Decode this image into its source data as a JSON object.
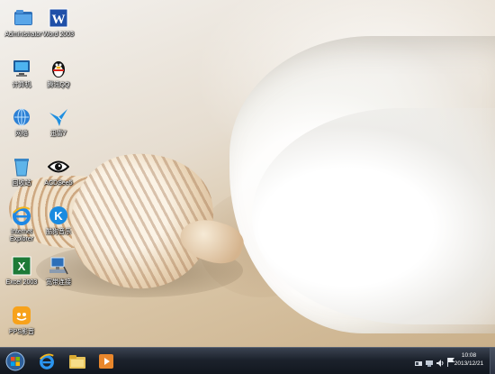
{
  "desktop": {
    "icons": [
      {
        "label": "Administrator",
        "icon": "user-folder-icon"
      },
      {
        "label": "Word 2003",
        "icon": "word-icon"
      },
      {
        "label": "计算机",
        "icon": "computer-icon"
      },
      {
        "label": "腾讯QQ",
        "icon": "qq-penguin-icon"
      },
      {
        "label": "网络",
        "icon": "network-globe-icon"
      },
      {
        "label": "迅雷7",
        "icon": "thunder-bird-icon"
      },
      {
        "label": "回收站",
        "icon": "recycle-bin-icon"
      },
      {
        "label": "ACDSee5",
        "icon": "acdsee-eye-icon"
      },
      {
        "label": "Internet\nExplorer",
        "icon": "internet-explorer-icon"
      },
      {
        "label": "酷狗音乐",
        "icon": "kugou-music-icon"
      },
      {
        "label": "Excel 2003",
        "icon": "excel-icon"
      },
      {
        "label": "宽带连接",
        "icon": "broadband-connection-icon"
      },
      {
        "label": "PPS影音",
        "icon": "pps-player-icon"
      }
    ]
  },
  "taskbar": {
    "start": "start-orb-icon",
    "pinned": [
      "internet-explorer-icon",
      "file-explorer-icon",
      "media-player-icon"
    ],
    "tray": [
      "action-center-icon",
      "network-icon",
      "volume-icon",
      "flag-icon"
    ],
    "clock": {
      "time": "10:08",
      "date": "2013/12/21"
    }
  },
  "colors": {
    "taskbar": "#1c222c",
    "sand": "#d9c5a6",
    "foam": "#ffffff"
  }
}
